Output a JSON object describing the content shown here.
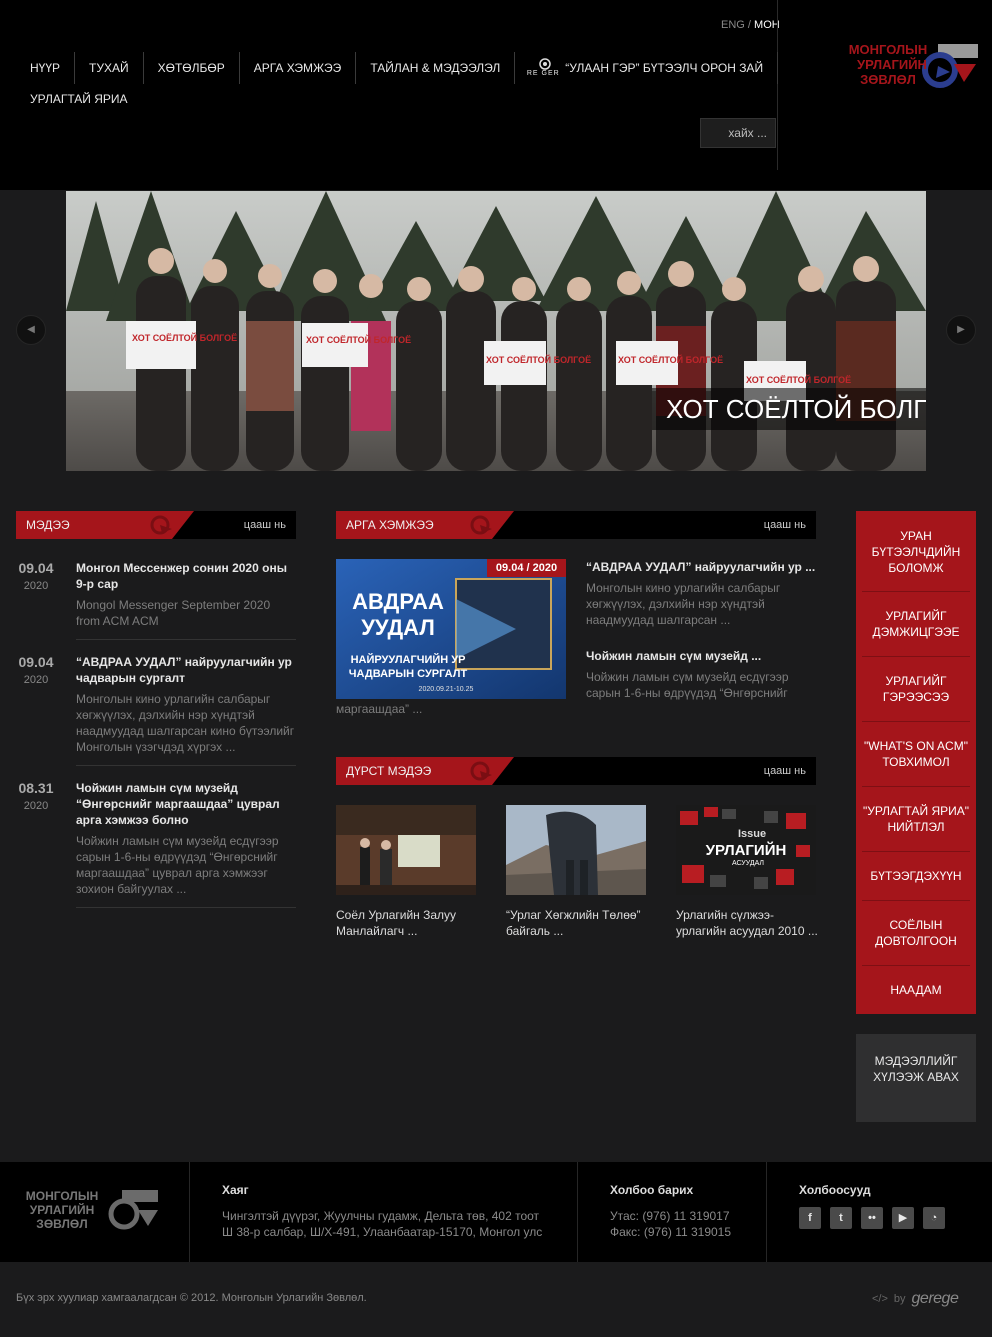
{
  "header": {
    "lang": {
      "eng": "ENG",
      "sep": "/",
      "mon": "МОН"
    },
    "nav": [
      "НҮҮР",
      "ТУХАЙ",
      "ХӨТӨЛБӨР",
      "АРГА ХЭМЖЭЭ",
      "ТАЙЛАН & МЭДЭЭЛЭЛ"
    ],
    "reger": {
      "logo_text": "RE GER",
      "label": "“УЛААН ГЭР” БҮТЭЭЛЧ ОРОН ЗАЙ"
    },
    "nav_row2": "УРЛАГТАЙ ЯРИА",
    "search_placeholder": "хайх ...",
    "logo_lines": [
      "МОНГОЛЫН",
      "УРЛАГИЙН",
      "ЗӨВЛӨЛ"
    ]
  },
  "slider": {
    "caption": "ХОТ СОЁЛТОЙ БОЛГОЁ",
    "sign_text": "ХОТ СОЁЛТОЙ БОЛГОЁ",
    "prev_icon": "chevron-left-icon",
    "next_icon": "chevron-right-icon"
  },
  "news": {
    "title": "МЭДЭЭ",
    "more": "цааш нь",
    "items": [
      {
        "day": "09.04",
        "year": "2020",
        "title": "Монгол Мессенжер сонин 2020 оны 9-р сар",
        "summary": "Mongol Messenger September 2020 from ACM ACM"
      },
      {
        "day": "09.04",
        "year": "2020",
        "title": "“АВДРАА УУДАЛ” найруулагчийн ур чадварын сургалт",
        "summary": "Монголын кино урлагийн салбарыг хөгжүүлэх, дэлхийн нэр хүндтэй наадмуудад шалгарсан кино бүтээлийг Монголын үзэгчдэд хүргэх ..."
      },
      {
        "day": "08.31",
        "year": "2020",
        "title": "Чойжин ламын сүм музейд “Өнгөрснийг маргаашдаа” цуврал арга хэмжээ болно",
        "summary": "Чойжин ламын сүм музейд есдүгээр сарын 1-6-ны өдрүүдэд “Өнгөрснийг маргаашдаа” цуврал арга хэмжээг зохион байгуулах ..."
      }
    ]
  },
  "events": {
    "title": "АРГА ХЭМЖЭЭ",
    "more": "цааш нь",
    "badge": "09.04 / 2020",
    "poster": {
      "line1": "АВДРАА",
      "line2": "УУДАЛ",
      "sub1": "НАЙРУУЛАГЧИЙН УР",
      "sub2": "ЧАДВАРЫН СУРГАЛТ",
      "dates": "2020.09.21-10.25"
    },
    "item1_title": "“АВДРАА УУДАЛ” найруулагчийн ур ...",
    "item1_summary": "Монголын кино урлагийн салбарыг хөгжүүлэх, дэлхийн нэр хүндтэй наадмуудад шалгарсан ...",
    "item2_title": "Чойжин ламын сүм музейд ...",
    "item2_summary": "Чойжин ламын сүм музейд есдүгээр сарын 1-6-ны өдрүүдэд “Өнгөрснийг",
    "item2_summary_cont": "маргаашдаа” ..."
  },
  "gallery": {
    "title": "ДҮРСТ МЭДЭЭ",
    "more": "цааш нь",
    "items": [
      {
        "caption": "Соёл Урлагийн Залуу Манлайлагч ..."
      },
      {
        "caption": "“Урлаг Хөгжлийн Төлөө” байгаль ..."
      },
      {
        "caption": "Урлагийн сүлжээ-урлагийн асуудал 2010 ...",
        "image_text1": "Issue",
        "image_text2": "УРЛАГИЙН",
        "image_text3": "АСУУДАЛ"
      }
    ]
  },
  "sidemenu": {
    "items": [
      "УРАН БҮТЭЭЛЧДИЙН БОЛОМЖ",
      "УРЛАГИЙГ ДЭМЖИЦГЭЭЕ",
      "УРЛАГИЙГ ГЭРЭЭСЭЭ",
      "\"WHAT'S ON ACM\" ТОВХИМОЛ",
      "\"УРЛАГТАЙ ЯРИА\" НИЙТЛЭЛ",
      "БҮТЭЭГДЭХҮҮН",
      "СОЁЛЫН ДОВТОЛГООН",
      "НААДАМ"
    ],
    "subscribe": "МЭДЭЭЛЛИЙГ ХҮЛЭЭЖ АВАХ"
  },
  "footer": {
    "logo_lines": [
      "МОНГОЛЫН",
      "УРЛАГИЙН",
      "ЗӨВЛӨЛ"
    ],
    "address_title": "Хаяг",
    "address_line1": "Чингэлтэй дүүрэг, Жуулчны гудамж, Дельта төв, 402 тоот",
    "address_line2": "Ш 38-р салбар, Ш/Х-491, Улаанбаатар-15170, Монгол улс",
    "contact_title": "Холбоо барих",
    "phone": "Утас: (976) 11 319017",
    "fax": "Факс: (976) 11 319015",
    "links_title": "Холбоосууд",
    "social": [
      {
        "name": "facebook-icon",
        "glyph": "f"
      },
      {
        "name": "twitter-icon",
        "glyph": "t"
      },
      {
        "name": "flickr-icon",
        "glyph": "••"
      },
      {
        "name": "youtube-icon",
        "glyph": "▶"
      },
      {
        "name": "rss-icon",
        "glyph": "◔"
      }
    ],
    "copyright": "Бүх эрх хуулиар хамгаалагдсан © 2012. Монголын Урлагийн Зөвлөл.",
    "by_icon": "</>",
    "by_text": "by",
    "by_brand": "gerege"
  },
  "colors": {
    "accent": "#a5151b",
    "background": "#1b1b1c",
    "header": "#000000",
    "logo_blue": "#2b3d8f"
  }
}
